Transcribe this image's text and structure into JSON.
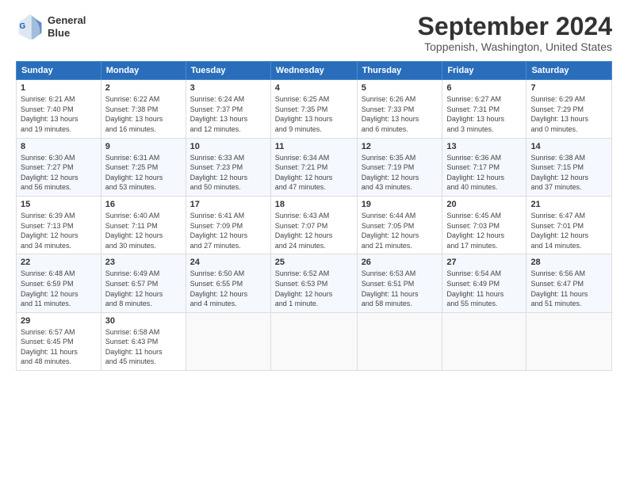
{
  "header": {
    "logo_line1": "General",
    "logo_line2": "Blue",
    "title": "September 2024",
    "subtitle": "Toppenish, Washington, United States"
  },
  "days_header": [
    "Sunday",
    "Monday",
    "Tuesday",
    "Wednesday",
    "Thursday",
    "Friday",
    "Saturday"
  ],
  "weeks": [
    [
      {
        "day": "1",
        "info": "Sunrise: 6:21 AM\nSunset: 7:40 PM\nDaylight: 13 hours\nand 19 minutes."
      },
      {
        "day": "2",
        "info": "Sunrise: 6:22 AM\nSunset: 7:38 PM\nDaylight: 13 hours\nand 16 minutes."
      },
      {
        "day": "3",
        "info": "Sunrise: 6:24 AM\nSunset: 7:37 PM\nDaylight: 13 hours\nand 12 minutes."
      },
      {
        "day": "4",
        "info": "Sunrise: 6:25 AM\nSunset: 7:35 PM\nDaylight: 13 hours\nand 9 minutes."
      },
      {
        "day": "5",
        "info": "Sunrise: 6:26 AM\nSunset: 7:33 PM\nDaylight: 13 hours\nand 6 minutes."
      },
      {
        "day": "6",
        "info": "Sunrise: 6:27 AM\nSunset: 7:31 PM\nDaylight: 13 hours\nand 3 minutes."
      },
      {
        "day": "7",
        "info": "Sunrise: 6:29 AM\nSunset: 7:29 PM\nDaylight: 13 hours\nand 0 minutes."
      }
    ],
    [
      {
        "day": "8",
        "info": "Sunrise: 6:30 AM\nSunset: 7:27 PM\nDaylight: 12 hours\nand 56 minutes."
      },
      {
        "day": "9",
        "info": "Sunrise: 6:31 AM\nSunset: 7:25 PM\nDaylight: 12 hours\nand 53 minutes."
      },
      {
        "day": "10",
        "info": "Sunrise: 6:33 AM\nSunset: 7:23 PM\nDaylight: 12 hours\nand 50 minutes."
      },
      {
        "day": "11",
        "info": "Sunrise: 6:34 AM\nSunset: 7:21 PM\nDaylight: 12 hours\nand 47 minutes."
      },
      {
        "day": "12",
        "info": "Sunrise: 6:35 AM\nSunset: 7:19 PM\nDaylight: 12 hours\nand 43 minutes."
      },
      {
        "day": "13",
        "info": "Sunrise: 6:36 AM\nSunset: 7:17 PM\nDaylight: 12 hours\nand 40 minutes."
      },
      {
        "day": "14",
        "info": "Sunrise: 6:38 AM\nSunset: 7:15 PM\nDaylight: 12 hours\nand 37 minutes."
      }
    ],
    [
      {
        "day": "15",
        "info": "Sunrise: 6:39 AM\nSunset: 7:13 PM\nDaylight: 12 hours\nand 34 minutes."
      },
      {
        "day": "16",
        "info": "Sunrise: 6:40 AM\nSunset: 7:11 PM\nDaylight: 12 hours\nand 30 minutes."
      },
      {
        "day": "17",
        "info": "Sunrise: 6:41 AM\nSunset: 7:09 PM\nDaylight: 12 hours\nand 27 minutes."
      },
      {
        "day": "18",
        "info": "Sunrise: 6:43 AM\nSunset: 7:07 PM\nDaylight: 12 hours\nand 24 minutes."
      },
      {
        "day": "19",
        "info": "Sunrise: 6:44 AM\nSunset: 7:05 PM\nDaylight: 12 hours\nand 21 minutes."
      },
      {
        "day": "20",
        "info": "Sunrise: 6:45 AM\nSunset: 7:03 PM\nDaylight: 12 hours\nand 17 minutes."
      },
      {
        "day": "21",
        "info": "Sunrise: 6:47 AM\nSunset: 7:01 PM\nDaylight: 12 hours\nand 14 minutes."
      }
    ],
    [
      {
        "day": "22",
        "info": "Sunrise: 6:48 AM\nSunset: 6:59 PM\nDaylight: 12 hours\nand 11 minutes."
      },
      {
        "day": "23",
        "info": "Sunrise: 6:49 AM\nSunset: 6:57 PM\nDaylight: 12 hours\nand 8 minutes."
      },
      {
        "day": "24",
        "info": "Sunrise: 6:50 AM\nSunset: 6:55 PM\nDaylight: 12 hours\nand 4 minutes."
      },
      {
        "day": "25",
        "info": "Sunrise: 6:52 AM\nSunset: 6:53 PM\nDaylight: 12 hours\nand 1 minute."
      },
      {
        "day": "26",
        "info": "Sunrise: 6:53 AM\nSunset: 6:51 PM\nDaylight: 11 hours\nand 58 minutes."
      },
      {
        "day": "27",
        "info": "Sunrise: 6:54 AM\nSunset: 6:49 PM\nDaylight: 11 hours\nand 55 minutes."
      },
      {
        "day": "28",
        "info": "Sunrise: 6:56 AM\nSunset: 6:47 PM\nDaylight: 11 hours\nand 51 minutes."
      }
    ],
    [
      {
        "day": "29",
        "info": "Sunrise: 6:57 AM\nSunset: 6:45 PM\nDaylight: 11 hours\nand 48 minutes."
      },
      {
        "day": "30",
        "info": "Sunrise: 6:58 AM\nSunset: 6:43 PM\nDaylight: 11 hours\nand 45 minutes."
      },
      null,
      null,
      null,
      null,
      null
    ]
  ]
}
